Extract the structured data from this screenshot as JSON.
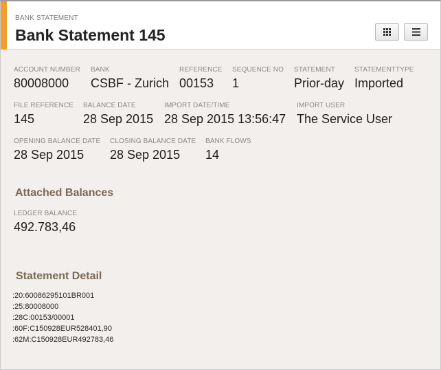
{
  "header": {
    "subtitle": "BANK STATEMENT",
    "title": "Bank Statement 145",
    "grid_icon": "grid-icon",
    "menu_icon": "menu-icon"
  },
  "fields": {
    "account_number": {
      "label": "ACCOUNT NUMBER",
      "value": "80008000"
    },
    "bank": {
      "label": "BANK",
      "value": "CSBF - Zurich"
    },
    "reference": {
      "label": "REFERENCE",
      "value": "00153"
    },
    "sequence_no": {
      "label": "SEQUENCE NO",
      "value": "1"
    },
    "statement": {
      "label": "STATEMENT",
      "value": "Prior-day"
    },
    "statement_type": {
      "label": "STATEMENTTYPE",
      "value": "Imported"
    },
    "file_reference": {
      "label": "FILE REFERENCE",
      "value": "145"
    },
    "balance_date": {
      "label": "BALANCE DATE",
      "value": "28 Sep 2015"
    },
    "import_datetime": {
      "label": "IMPORT DATE/TIME",
      "value": "28 Sep 2015 13:56:47"
    },
    "import_user": {
      "label": "IMPORT USER",
      "value": "The Service User"
    },
    "opening_balance_date": {
      "label": "OPENING BALANCE DATE",
      "value": "28 Sep 2015"
    },
    "closing_balance_date": {
      "label": "CLOSING BALANCE DATE",
      "value": "28 Sep 2015"
    },
    "bank_flows": {
      "label": "BANK FLOWS",
      "value": "14"
    }
  },
  "attached_balances": {
    "title": "Attached Balances",
    "ledger_balance": {
      "label": "LEDGER BALANCE",
      "value": "492.783,46"
    }
  },
  "statement_detail": {
    "title": "Statement Detail",
    "lines": [
      ":20:60086295101BR001",
      ":25:80008000",
      ":28C:00153/00001",
      ":60F:C150928EUR528401,90",
      ":62M:C150928EUR492783,46"
    ]
  },
  "colors": {
    "accent": "#f0a030",
    "section_title": "#7a6a52",
    "background": "#f2efec"
  }
}
